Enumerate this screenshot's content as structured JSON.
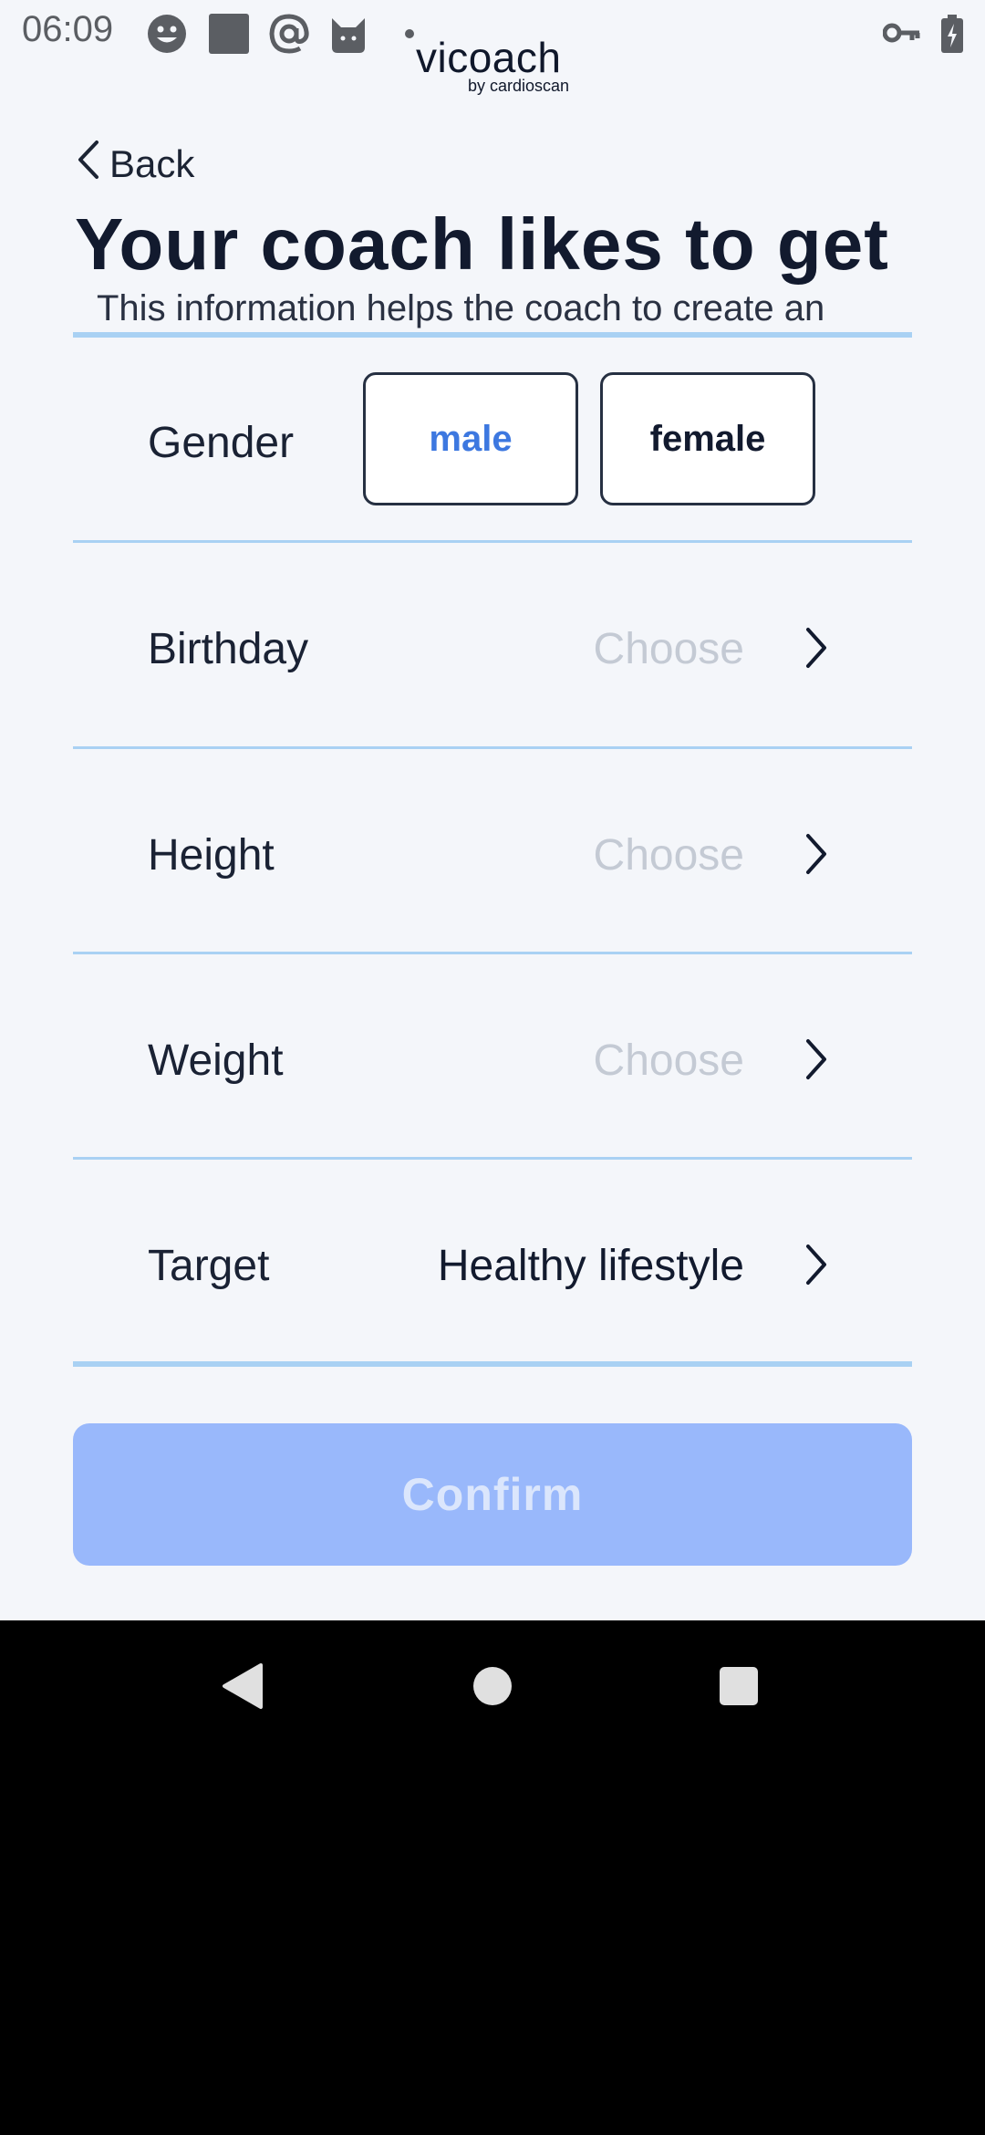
{
  "status_bar": {
    "time": "06:09",
    "icons": [
      "smiley-icon",
      "square-app-icon",
      "at-icon",
      "cat-icon",
      "dot-icon",
      "key-icon",
      "battery-icon"
    ]
  },
  "app": {
    "logo": "vicoach",
    "logo_sub": "by cardioscan"
  },
  "header": {
    "back_label": "Back",
    "title": "Your coach likes to get",
    "subtitle": "This information helps the coach to create an"
  },
  "form": {
    "gender": {
      "label": "Gender",
      "options": [
        "male",
        "female"
      ],
      "selected": "male"
    },
    "birthday": {
      "label": "Birthday",
      "value": "Choose"
    },
    "height": {
      "label": "Height",
      "value": "Choose"
    },
    "weight": {
      "label": "Weight",
      "value": "Choose"
    },
    "target": {
      "label": "Target",
      "value": "Healthy lifestyle"
    }
  },
  "confirm_label": "Confirm",
  "colors": {
    "accent": "#3d78e0",
    "placeholder": "#c4cad4",
    "divider": "#a9d1f3",
    "confirm_bg": "#99b8fb"
  }
}
